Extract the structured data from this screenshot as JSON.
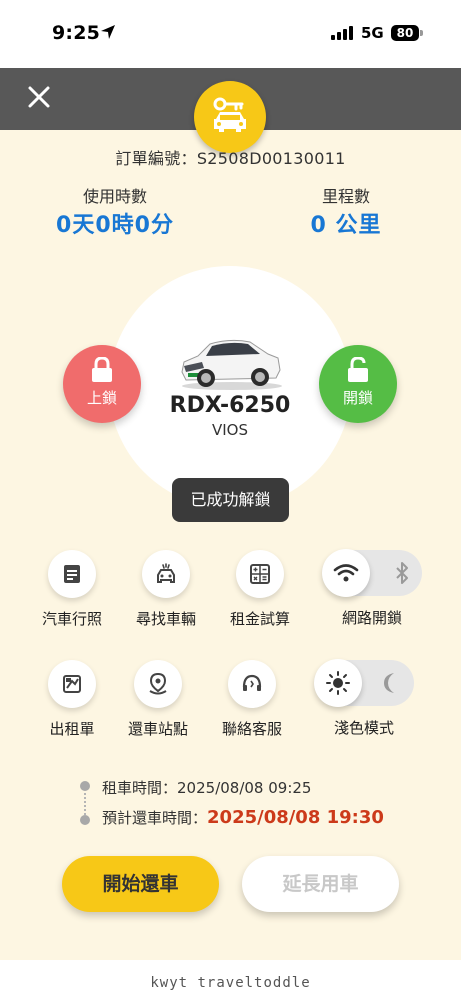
{
  "status_bar": {
    "time": "9:25",
    "network": "5G",
    "battery": "80"
  },
  "order": {
    "label": "訂單編號：",
    "number": "S2508D00130011"
  },
  "stats": {
    "usage_label": "使用時數",
    "usage_value": "0天0時0分",
    "mileage_label": "里程數",
    "mileage_value": "0 公里"
  },
  "car": {
    "plate": "RDX-6250",
    "model": "VIOS"
  },
  "lock": {
    "lock_label": "上鎖",
    "unlock_label": "開鎖"
  },
  "toast": "已成功解鎖",
  "features": [
    {
      "label": "汽車行照",
      "icon": "document-icon"
    },
    {
      "label": "尋找車輛",
      "icon": "car-horn-icon"
    },
    {
      "label": "租金試算",
      "icon": "calculator-icon"
    },
    {
      "label": "網路開鎖",
      "icon": "wifi-bluetooth-toggle"
    },
    {
      "label": "出租單",
      "icon": "rental-form-icon"
    },
    {
      "label": "還車站點",
      "icon": "location-pin-icon"
    },
    {
      "label": "聯絡客服",
      "icon": "headset-icon"
    },
    {
      "label": "淺色模式",
      "icon": "sun-moon-toggle"
    }
  ],
  "timeline": {
    "rent_label": "租車時間：",
    "rent_value": "2025/08/08 09:25",
    "return_label": "預計還車時間：",
    "return_value": "2025/08/08 19:30"
  },
  "actions": {
    "start_return": "開始還車",
    "extend": "延長用車"
  },
  "watermark": "kwyt traveltoddle",
  "colors": {
    "brand_yellow": "#f7c817",
    "lock_red": "#f06c6c",
    "unlock_green": "#55bd45",
    "accent_blue": "#1877d4",
    "return_red": "#cc3a1a"
  }
}
